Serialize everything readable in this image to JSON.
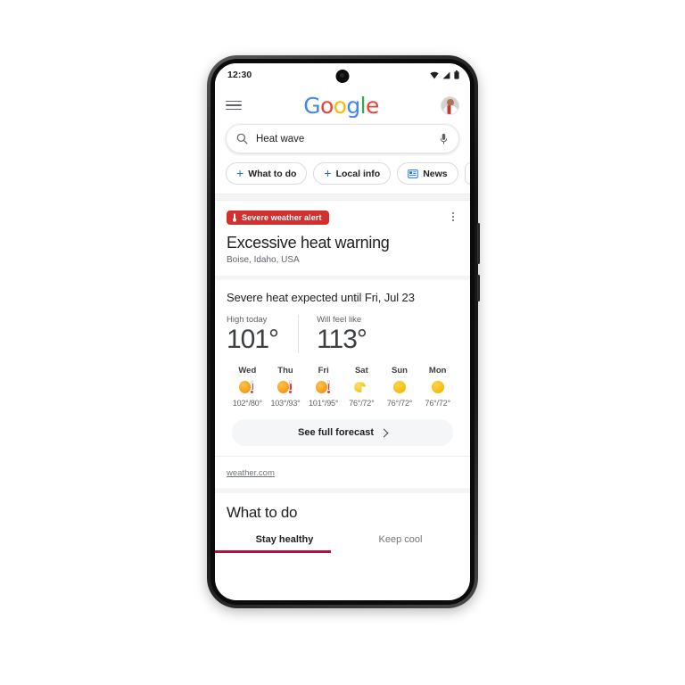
{
  "status_bar": {
    "time": "12:30",
    "icons": [
      "wifi-icon",
      "cellular-signal-icon",
      "battery-icon"
    ]
  },
  "header": {
    "menu_icon": "hamburger-menu-icon",
    "logo_text": "Google",
    "logo_letters": [
      {
        "char": "G",
        "color": "#4285F4"
      },
      {
        "char": "o",
        "color": "#EA4335"
      },
      {
        "char": "o",
        "color": "#FBBC05"
      },
      {
        "char": "g",
        "color": "#4285F4"
      },
      {
        "char": "l",
        "color": "#34A853"
      },
      {
        "char": "e",
        "color": "#EA4335"
      }
    ],
    "avatar_label": "account-avatar"
  },
  "search": {
    "query": "Heat wave",
    "placeholder": "Search",
    "search_icon": "search-icon",
    "mic_icon": "microphone-icon"
  },
  "chips": [
    {
      "label": "What to do",
      "icon": "plus-icon"
    },
    {
      "label": "Local info",
      "icon": "plus-icon"
    },
    {
      "label": "News",
      "icon": "news-icon"
    },
    {
      "label": "",
      "icon": "partial-chip-icon"
    }
  ],
  "alert": {
    "badge_text": "Severe weather alert",
    "badge_icon": "thermometer-icon",
    "badge_color": "#d32f2f",
    "title": "Excessive heat warning",
    "location": "Boise, Idaho, USA",
    "overflow_icon": "kebab-menu-icon"
  },
  "forecast": {
    "headline": "Severe heat expected until Fri, Jul 23",
    "high_today_label": "High today",
    "high_today_value": "101°",
    "feels_like_label": "Will feel like",
    "feels_like_value": "113°",
    "days": [
      {
        "name": "Wed",
        "icon": "sun-thermometer-icon",
        "high": "102°",
        "low": "80°",
        "temp": "102°/80°"
      },
      {
        "name": "Thu",
        "icon": "sun-thermometer-icon",
        "high": "103°",
        "low": "93°",
        "temp": "103°/93°"
      },
      {
        "name": "Fri",
        "icon": "sun-thermometer-icon",
        "high": "101°",
        "low": "95°",
        "temp": "101°/95°"
      },
      {
        "name": "Sat",
        "icon": "partly-sunny-icon",
        "high": "76°",
        "low": "72°",
        "temp": "76°/72°"
      },
      {
        "name": "Sun",
        "icon": "sunny-icon",
        "high": "76°",
        "low": "72°",
        "temp": "76°/72°"
      },
      {
        "name": "Mon",
        "icon": "sunny-icon",
        "high": "76°",
        "low": "72°",
        "temp": "76°/72°"
      }
    ],
    "full_forecast_label": "See full forecast",
    "chevron_icon": "chevron-right-icon",
    "source": "weather.com"
  },
  "what_to_do": {
    "title": "What to do",
    "tabs": [
      {
        "label": "Stay healthy",
        "active": true
      },
      {
        "label": "Keep cool",
        "active": false
      }
    ],
    "active_indicator_color": "#b3123c"
  }
}
